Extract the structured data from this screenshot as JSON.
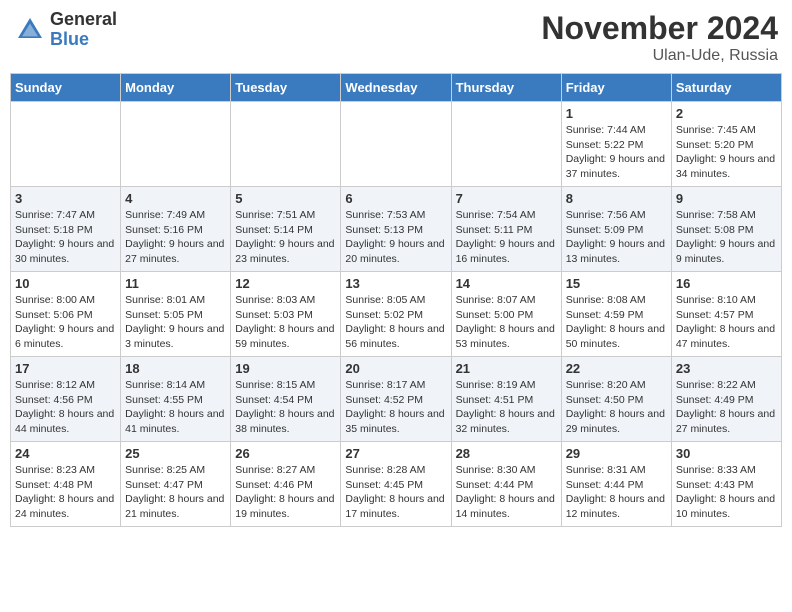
{
  "logo": {
    "general": "General",
    "blue": "Blue"
  },
  "title": "November 2024",
  "location": "Ulan-Ude, Russia",
  "days_of_week": [
    "Sunday",
    "Monday",
    "Tuesday",
    "Wednesday",
    "Thursday",
    "Friday",
    "Saturday"
  ],
  "weeks": [
    [
      {
        "day": "",
        "info": ""
      },
      {
        "day": "",
        "info": ""
      },
      {
        "day": "",
        "info": ""
      },
      {
        "day": "",
        "info": ""
      },
      {
        "day": "",
        "info": ""
      },
      {
        "day": "1",
        "info": "Sunrise: 7:44 AM\nSunset: 5:22 PM\nDaylight: 9 hours and 37 minutes."
      },
      {
        "day": "2",
        "info": "Sunrise: 7:45 AM\nSunset: 5:20 PM\nDaylight: 9 hours and 34 minutes."
      }
    ],
    [
      {
        "day": "3",
        "info": "Sunrise: 7:47 AM\nSunset: 5:18 PM\nDaylight: 9 hours and 30 minutes."
      },
      {
        "day": "4",
        "info": "Sunrise: 7:49 AM\nSunset: 5:16 PM\nDaylight: 9 hours and 27 minutes."
      },
      {
        "day": "5",
        "info": "Sunrise: 7:51 AM\nSunset: 5:14 PM\nDaylight: 9 hours and 23 minutes."
      },
      {
        "day": "6",
        "info": "Sunrise: 7:53 AM\nSunset: 5:13 PM\nDaylight: 9 hours and 20 minutes."
      },
      {
        "day": "7",
        "info": "Sunrise: 7:54 AM\nSunset: 5:11 PM\nDaylight: 9 hours and 16 minutes."
      },
      {
        "day": "8",
        "info": "Sunrise: 7:56 AM\nSunset: 5:09 PM\nDaylight: 9 hours and 13 minutes."
      },
      {
        "day": "9",
        "info": "Sunrise: 7:58 AM\nSunset: 5:08 PM\nDaylight: 9 hours and 9 minutes."
      }
    ],
    [
      {
        "day": "10",
        "info": "Sunrise: 8:00 AM\nSunset: 5:06 PM\nDaylight: 9 hours and 6 minutes."
      },
      {
        "day": "11",
        "info": "Sunrise: 8:01 AM\nSunset: 5:05 PM\nDaylight: 9 hours and 3 minutes."
      },
      {
        "day": "12",
        "info": "Sunrise: 8:03 AM\nSunset: 5:03 PM\nDaylight: 8 hours and 59 minutes."
      },
      {
        "day": "13",
        "info": "Sunrise: 8:05 AM\nSunset: 5:02 PM\nDaylight: 8 hours and 56 minutes."
      },
      {
        "day": "14",
        "info": "Sunrise: 8:07 AM\nSunset: 5:00 PM\nDaylight: 8 hours and 53 minutes."
      },
      {
        "day": "15",
        "info": "Sunrise: 8:08 AM\nSunset: 4:59 PM\nDaylight: 8 hours and 50 minutes."
      },
      {
        "day": "16",
        "info": "Sunrise: 8:10 AM\nSunset: 4:57 PM\nDaylight: 8 hours and 47 minutes."
      }
    ],
    [
      {
        "day": "17",
        "info": "Sunrise: 8:12 AM\nSunset: 4:56 PM\nDaylight: 8 hours and 44 minutes."
      },
      {
        "day": "18",
        "info": "Sunrise: 8:14 AM\nSunset: 4:55 PM\nDaylight: 8 hours and 41 minutes."
      },
      {
        "day": "19",
        "info": "Sunrise: 8:15 AM\nSunset: 4:54 PM\nDaylight: 8 hours and 38 minutes."
      },
      {
        "day": "20",
        "info": "Sunrise: 8:17 AM\nSunset: 4:52 PM\nDaylight: 8 hours and 35 minutes."
      },
      {
        "day": "21",
        "info": "Sunrise: 8:19 AM\nSunset: 4:51 PM\nDaylight: 8 hours and 32 minutes."
      },
      {
        "day": "22",
        "info": "Sunrise: 8:20 AM\nSunset: 4:50 PM\nDaylight: 8 hours and 29 minutes."
      },
      {
        "day": "23",
        "info": "Sunrise: 8:22 AM\nSunset: 4:49 PM\nDaylight: 8 hours and 27 minutes."
      }
    ],
    [
      {
        "day": "24",
        "info": "Sunrise: 8:23 AM\nSunset: 4:48 PM\nDaylight: 8 hours and 24 minutes."
      },
      {
        "day": "25",
        "info": "Sunrise: 8:25 AM\nSunset: 4:47 PM\nDaylight: 8 hours and 21 minutes."
      },
      {
        "day": "26",
        "info": "Sunrise: 8:27 AM\nSunset: 4:46 PM\nDaylight: 8 hours and 19 minutes."
      },
      {
        "day": "27",
        "info": "Sunrise: 8:28 AM\nSunset: 4:45 PM\nDaylight: 8 hours and 17 minutes."
      },
      {
        "day": "28",
        "info": "Sunrise: 8:30 AM\nSunset: 4:44 PM\nDaylight: 8 hours and 14 minutes."
      },
      {
        "day": "29",
        "info": "Sunrise: 8:31 AM\nSunset: 4:44 PM\nDaylight: 8 hours and 12 minutes."
      },
      {
        "day": "30",
        "info": "Sunrise: 8:33 AM\nSunset: 4:43 PM\nDaylight: 8 hours and 10 minutes."
      }
    ]
  ]
}
